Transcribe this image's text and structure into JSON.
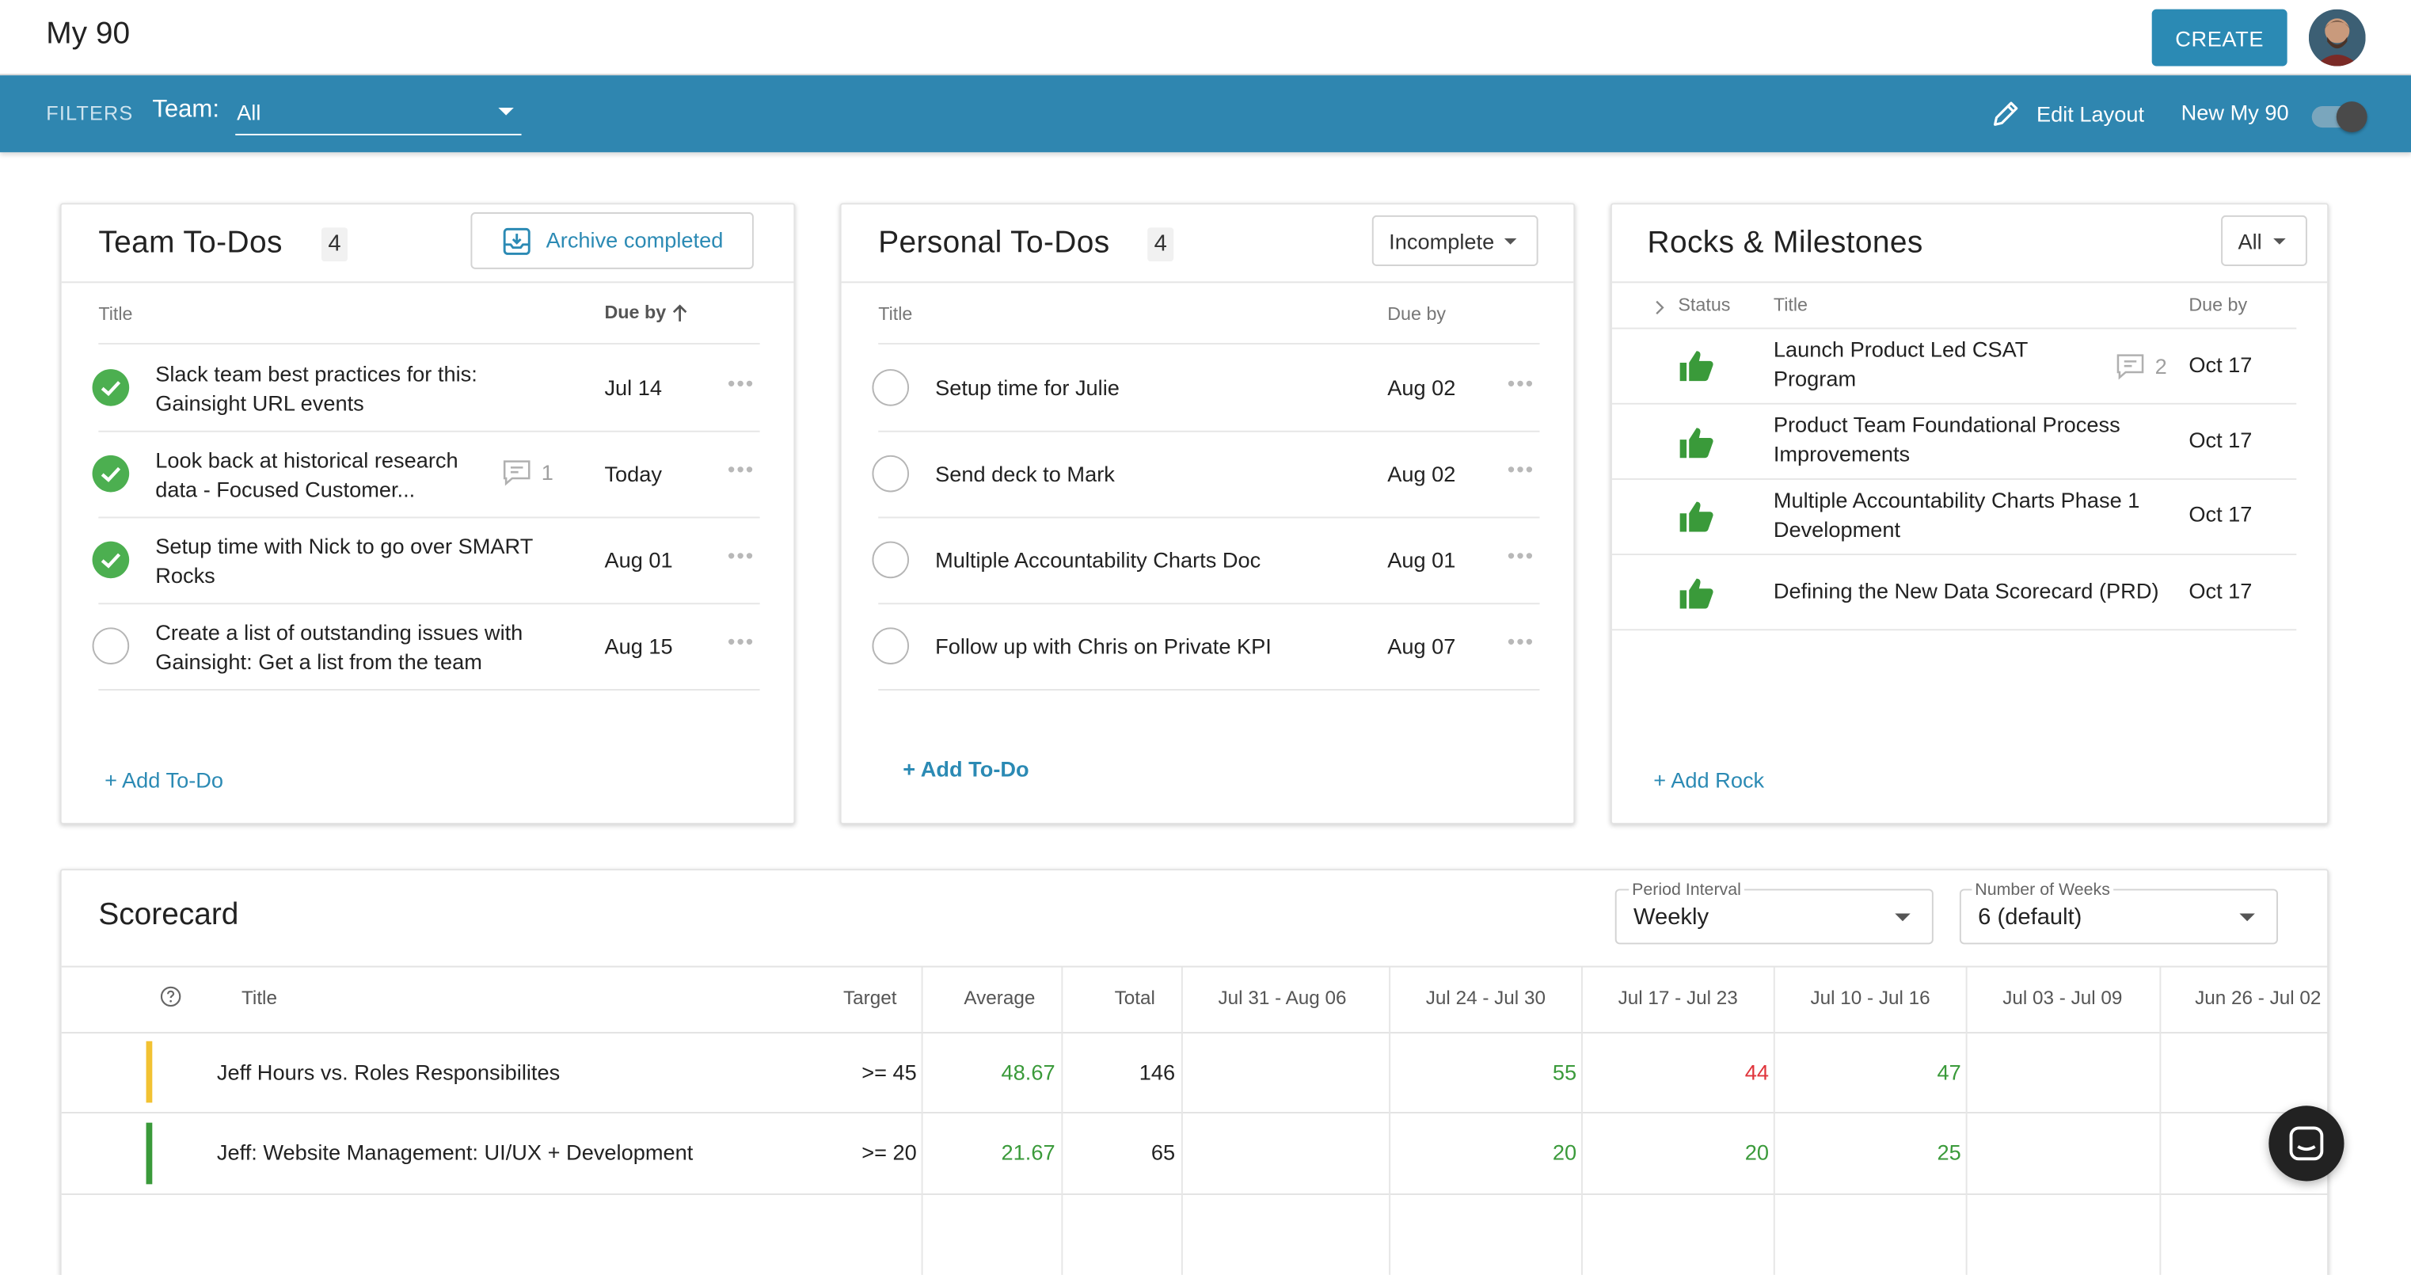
{
  "app": {
    "title": "My 90",
    "create_label": "CREATE"
  },
  "filters": {
    "label": "FILTERS",
    "team_label": "Team:",
    "team_value": "All",
    "edit_layout_label": "Edit Layout",
    "new_my90_label": "New My 90",
    "new_my90_enabled": true
  },
  "team_todos": {
    "title": "Team To-Dos",
    "count": "4",
    "archive_label": "Archive completed",
    "col_title": "Title",
    "col_due": "Due by",
    "add_label": "+ Add To-Do",
    "rows": [
      {
        "line1": "Slack team best practices for this:",
        "line2": "Gainsight URL events",
        "due": "Jul 14",
        "done": true,
        "comments": ""
      },
      {
        "line1": "Look back at historical research",
        "line2": "data - Focused Customer...",
        "due": "Today",
        "done": true,
        "comments": "1"
      },
      {
        "line1": "Setup time with Nick to go over SMART",
        "line2": "Rocks",
        "due": "Aug 01",
        "done": true,
        "comments": ""
      },
      {
        "line1": "Create a list of outstanding issues with",
        "line2": "Gainsight: Get a list from the team",
        "due": "Aug 15",
        "done": false,
        "comments": ""
      }
    ]
  },
  "personal_todos": {
    "title": "Personal To-Dos",
    "count": "4",
    "filter_value": "Incomplete",
    "col_title": "Title",
    "col_due": "Due by",
    "add_label": "+ Add To-Do",
    "rows": [
      {
        "text": "Setup time for Julie",
        "due": "Aug 02"
      },
      {
        "text": "Send deck to Mark",
        "due": "Aug 02"
      },
      {
        "text": "Multiple Accountability Charts Doc",
        "due": "Aug 01"
      },
      {
        "text": "Follow up with Chris on Private KPI",
        "due": "Aug 07"
      }
    ]
  },
  "rocks": {
    "title": "Rocks & Milestones",
    "filter_value": "All",
    "col_status": "Status",
    "col_title": "Title",
    "col_due": "Due by",
    "add_label": "+ Add Rock",
    "rows": [
      {
        "line1": "Launch Product Led CSAT",
        "line2": "Program",
        "due": "Oct 17",
        "comments": "2"
      },
      {
        "line1": "Product Team Foundational Process",
        "line2": "Improvements",
        "due": "Oct 17",
        "comments": ""
      },
      {
        "line1": "Multiple Accountability Charts Phase 1",
        "line2": "Development",
        "due": "Oct 17",
        "comments": ""
      },
      {
        "line1": "Defining the New Data Scorecard (PRD)",
        "line2": "",
        "due": "Oct 17",
        "comments": ""
      }
    ]
  },
  "scorecard": {
    "title": "Scorecard",
    "period_label": "Period Interval",
    "period_value": "Weekly",
    "weeks_label": "Number of Weeks",
    "weeks_value": "6 (default)",
    "headers": {
      "title": "Title",
      "target": "Target",
      "average": "Average",
      "total": "Total",
      "w1": "Jul 31 - Aug 06",
      "w2": "Jul 24 - Jul 30",
      "w3": "Jul 17 - Jul 23",
      "w4": "Jul 10 - Jul 16",
      "w5": "Jul 03 - Jul 09",
      "w6": "Jun 26 - Jul 02"
    },
    "rows": [
      {
        "title": "Jeff Hours vs. Roles Responsibilites",
        "status_color": "#f2c232",
        "target": ">= 45",
        "average": "48.67",
        "total": "146",
        "w1": "",
        "w2": "55",
        "w3": "44",
        "w4": "47",
        "w5": "",
        "w6": ""
      },
      {
        "title": "Jeff: Website Management: UI/UX + Development",
        "status_color": "#3a9a3a",
        "target": ">= 20",
        "average": "21.67",
        "total": "65",
        "w1": "",
        "w2": "20",
        "w3": "20",
        "w4": "25",
        "w5": "",
        "w6": ""
      }
    ]
  },
  "colors": {
    "accent": "#2b8ab4",
    "filter_bar": "#2f86b0",
    "done_green": "#4caf50",
    "good": "#3a9a3a",
    "bad": "#e0353c"
  },
  "icons": [
    "avatar",
    "chevron-down-icon",
    "pencil-icon",
    "archive-icon",
    "check-icon",
    "comment-icon",
    "more-icon",
    "thumbs-up-icon",
    "help-icon",
    "chat-icon",
    "sort-arrow-icon",
    "expand-icon"
  ]
}
